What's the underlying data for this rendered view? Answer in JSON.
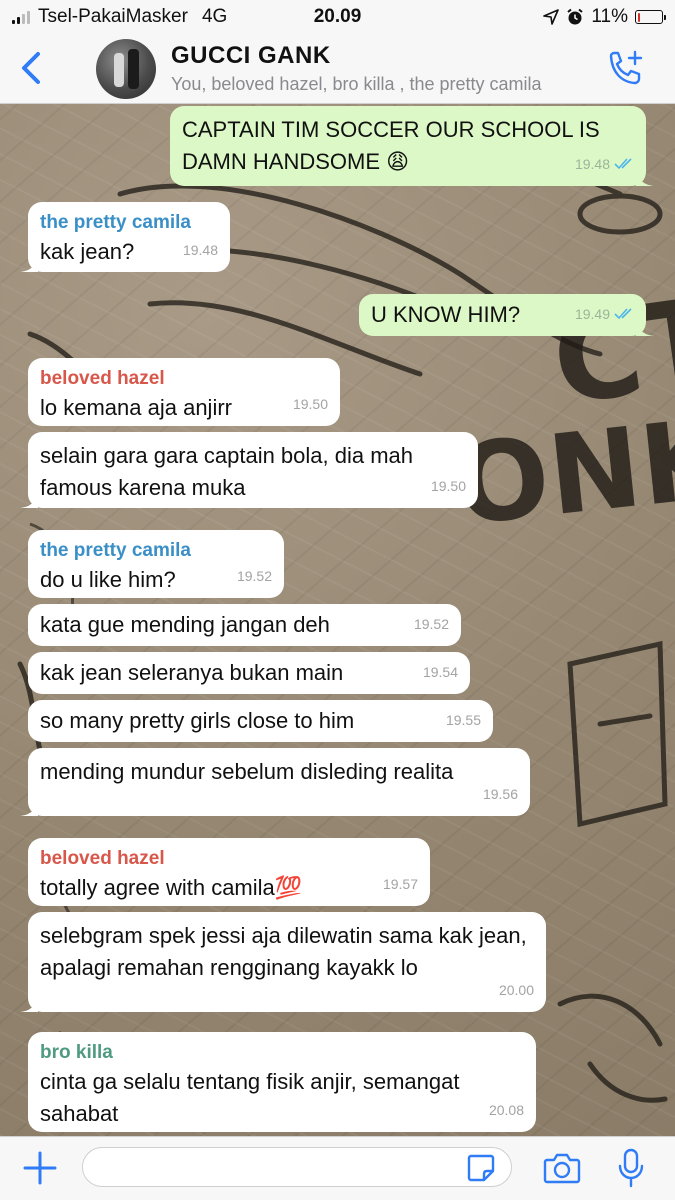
{
  "status_bar": {
    "carrier": "Tsel-PakaiMasker",
    "network": "4G",
    "time": "20.09",
    "battery_percent": "11%",
    "battery_level": 0.11,
    "battery_color": "#d32f2f"
  },
  "header": {
    "group_name": "GUCCI GANK",
    "members": "You, beloved hazel, bro killa , the pretty camila",
    "icons": [
      "chevron-left-icon",
      "group-avatar",
      "add-call-icon"
    ],
    "accent_color": "#2f7cf6"
  },
  "colors": {
    "incoming_bubble": "#ffffff",
    "outgoing_bubble": "#dcf8c6",
    "sender_camila": "#3a8fc7",
    "sender_hazel": "#d8574b",
    "sender_killa": "#4f9a80",
    "read_ticks": "#4fb6ec"
  },
  "messages": [
    {
      "direction": "out",
      "text": "CAPTAIN TIM SOCCER OUR SCHOOL IS DAMN HANDSOME 😩",
      "time": "19.48",
      "read": true
    },
    {
      "direction": "in",
      "sender": "the pretty camila",
      "text": "kak jean?",
      "time": "19.48"
    },
    {
      "direction": "out",
      "text": "U KNOW HIM?",
      "time": "19.49",
      "read": true
    },
    {
      "direction": "in",
      "sender": "beloved hazel",
      "text": "lo kemana aja anjirr",
      "time": "19.50"
    },
    {
      "direction": "in",
      "text": "selain gara gara captain bola, dia mah famous karena muka",
      "time": "19.50"
    },
    {
      "direction": "in",
      "sender": "the pretty camila",
      "text": "do u like him?",
      "time": "19.52"
    },
    {
      "direction": "in",
      "text": "kata gue mending jangan deh",
      "time": "19.52"
    },
    {
      "direction": "in",
      "text": "kak jean seleranya bukan main",
      "time": "19.54"
    },
    {
      "direction": "in",
      "text": "so many pretty girls close to him",
      "time": "19.55"
    },
    {
      "direction": "in",
      "text": "mending mundur sebelum disleding realita",
      "time": "19.56"
    },
    {
      "direction": "in",
      "sender": "beloved hazel",
      "text": "totally agree with camila💯",
      "time": "19.57"
    },
    {
      "direction": "in",
      "text": "selebgram spek jessi aja dilewatin sama kak jean, apalagi remahan rengginang kayakk lo",
      "time": "20.00"
    },
    {
      "direction": "in",
      "sender": "bro killa",
      "text": "cinta ga selalu tentang fisik anjir, semangat sahabat",
      "time": "20.08"
    }
  ],
  "input_bar": {
    "placeholder": "",
    "icons": [
      "plus-icon",
      "sticker-icon",
      "camera-icon",
      "microphone-icon"
    ]
  }
}
